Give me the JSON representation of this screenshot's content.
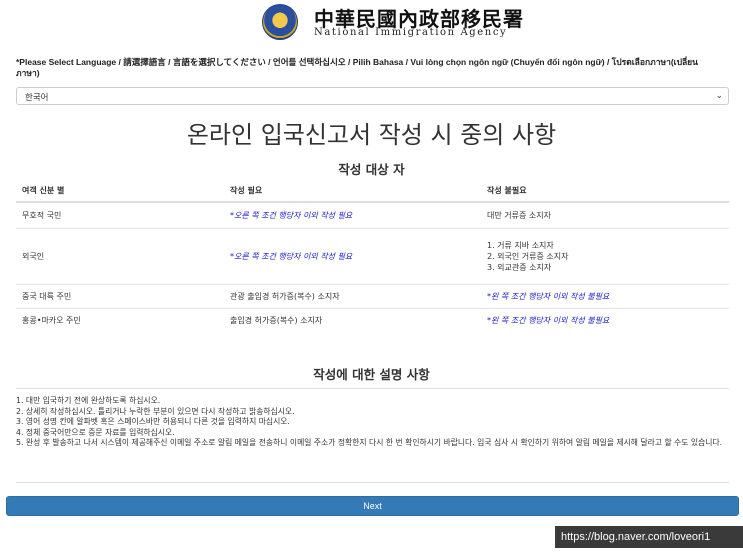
{
  "header": {
    "agency_cn": "中華民國內政部移民署",
    "agency_en": "National Immigration Agency"
  },
  "language": {
    "label": "*Please Select Language / 請選擇語言 / 言語を選択してください / 언어를 선택하십시오 / Pilih Bahasa / Vui lòng chọn ngôn ngữ (Chuyển đổi ngôn ngữ) / โปรดเลือกภาษา(เปลี่ยนภาษา)",
    "selected": "한국어"
  },
  "page_title": "온라인 입국신고서 작성 시 중의 사항",
  "targets": {
    "title": "작성 대상 자",
    "headers": [
      "여객 신분 별",
      "작성 필요",
      "작성 불필요"
    ],
    "rows": [
      [
        "무호적 국민",
        "*오른 쪽 조건 행당자 이외 작성 필요",
        "대만 거류증 소지자"
      ],
      [
        "외국인",
        "*오른 쪽 조건 행당자 이외 작성 필요",
        "1. 거류 지바 소지자",
        "2. 외국인 거류증 소지자",
        "3. 외교관증 소지자"
      ],
      [
        "중국 대륙 주민",
        "관광 출입경 허가증(복수) 소지자",
        "*왼 쪽 조건 행당자 이외 작성 불필요"
      ],
      [
        "홍콩•마카오 주민",
        "출입경 허가증(복수) 소지자",
        "*왼 쪽 조건 행당자 이외 작성 불필요"
      ]
    ]
  },
  "instructions": {
    "title": "작성에 대한 설명 사항",
    "lines": [
      "1. 대만 입국하기 전에 완상하도록 하십시오.",
      "2. 상세히 작성하십시오. 틀리거나 누락한 부분이 있으면 다시 작성하고 밝송하십시오.",
      "3. 영어 성명 칸에 알파벳 혹은 스페이스바만 허용되니 다른 것을 입력하지 마십시오.",
      "4. 정체 중국어만으로 증문 자료를 입력하십시오.",
      "5. 완성 후 발송하고 나서 시스템이 제공해주신 이메일 주소로 알림 메일을 전송하니 이메일 주소가 정확한지 다시 한 번 확인하시기 바랍니다. 입국 심사 시 확인하기 위하여 알림 메일을 제시해 달라고 할 수도 있습니다."
    ]
  },
  "next_button": "Next",
  "watermark": "https://blog.naver.com/loveori1",
  "colors": {
    "button": "#337ab7",
    "link_text": "#1a1acc"
  }
}
